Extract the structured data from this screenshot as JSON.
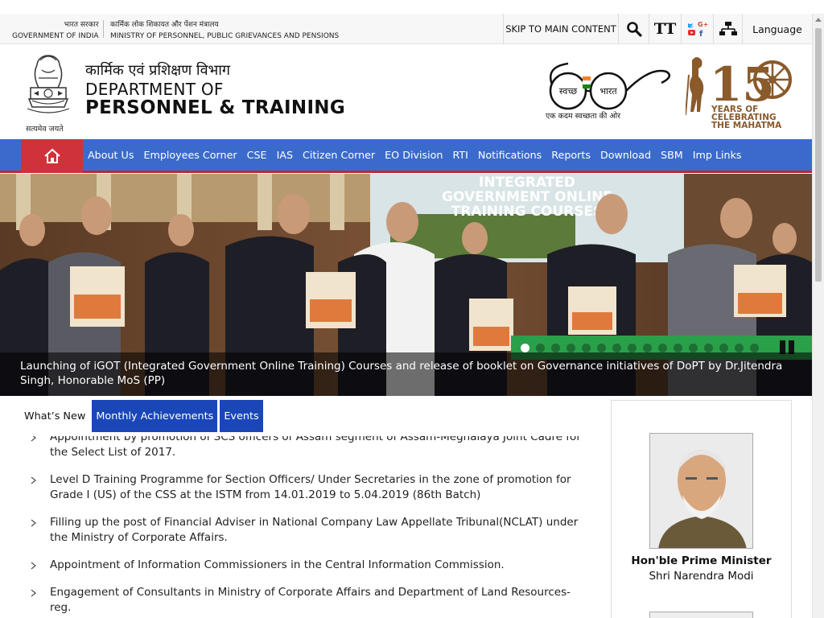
{
  "topbar": {
    "gov_hi": "भारत सरकार",
    "gov_en": "GOVERNMENT OF INDIA",
    "ministry_hi": "कार्मिक लोक शिकायत और पेंशन मंत्रालय",
    "ministry_en": "MINISTRY OF PERSONNEL, PUBLIC GRIEVANCES AND PENSIONS",
    "skip": "SKIP TO MAIN CONTENT",
    "text_size": "TT",
    "language": "Language"
  },
  "header": {
    "emblem_motto": "सत्यमेव जयते",
    "dept_hi": "कार्मिक एवं प्रशिक्षण विभाग",
    "dept_line1": "DEPARTMENT OF",
    "dept_line2": "PERSONNEL & TRAINING",
    "swachh_left": "स्वच्छ",
    "swachh_right": "भारत",
    "swachh_tagline": "एक कदम स्वच्छता की ओर",
    "gandhi_years": "YEARS OF",
    "gandhi_celebrating": "CELEBRATING",
    "gandhi_mahatma": "THE MAHATMA"
  },
  "nav": {
    "items": [
      "About Us",
      "Employees Corner",
      "CSE",
      "IAS",
      "Citizen Corner",
      "EO Division",
      "RTI",
      "Notifications",
      "Reports",
      "Download",
      "SBM",
      "Imp Links"
    ]
  },
  "slider": {
    "screen_line1": "INTEGRATED",
    "screen_line2": "GOVERNMENT ONLINE",
    "screen_line3": "TRAINING COURSES",
    "caption": "Launching of iGOT (Integrated Government Online Training) Courses and release of booklet on Governance initiatives of DoPT by Dr.Jitendra Singh, Honorable MoS (PP)",
    "dot_count": 16,
    "active_dot": 0
  },
  "tabs": {
    "whats_new": "What’s New",
    "monthly": "Monthly Achievements",
    "events": "Events"
  },
  "news": [
    "Appointment by promotion of SCS officers of Assam segment of Assam-Meghalaya Joint Cadre for the Select List of 2017.",
    "Level D Training Programme for Section Officers/ Under Secretaries in the zone of promotion for Grade I (US) of the CSS at the ISTM from 14.01.2019 to 5.04.2019 (86th Batch)",
    "Filling up the post of Financial Adviser in National Company Law Appellate Tribunal(NCLAT) under the Ministry of Corporate Affairs.",
    "Appointment of Information Commissioners in the Central Information Commission.",
    "Engagement of Consultants in Ministry of Corporate Affairs and Department of Land Resources-reg."
  ],
  "pm": {
    "title": "Hon'ble Prime Minister",
    "name": "Shri Narendra Modi"
  },
  "colors": {
    "nav_blue": "#3a6bcc",
    "home_red": "#d03239",
    "tab_blue": "#1a47b8",
    "slider_green": "#2aa04a"
  }
}
